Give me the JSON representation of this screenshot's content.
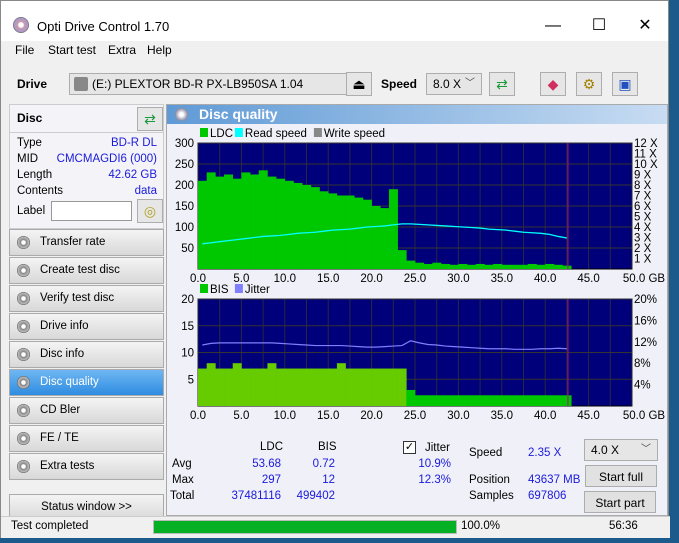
{
  "window": {
    "title": "Opti Drive Control 1.70",
    "minimize": "—",
    "maximize": "☐",
    "close": "✕"
  },
  "menu": [
    "File",
    "Start test",
    "Extra",
    "Help"
  ],
  "toolbar": {
    "drive_label": "Drive",
    "drive_value": "(E:)  PLEXTOR BD-R  PX-LB950SA 1.04",
    "speed_label": "Speed",
    "speed_value": "8.0 X"
  },
  "disc": {
    "title": "Disc",
    "fields": [
      {
        "k": "Type",
        "v": "BD-R DL"
      },
      {
        "k": "MID",
        "v": "CMCMAGDI6 (000)"
      },
      {
        "k": "Length",
        "v": "42.62 GB"
      },
      {
        "k": "Contents",
        "v": "data"
      }
    ],
    "label_label": "Label",
    "label_value": ""
  },
  "nav": [
    "Transfer rate",
    "Create test disc",
    "Verify test disc",
    "Drive info",
    "Disc info",
    "Disc quality",
    "CD Bler",
    "FE / TE",
    "Extra tests"
  ],
  "nav_selected": "Disc quality",
  "status_window_button": "Status window >>",
  "panel_title": "Disc quality",
  "stats": {
    "headers": [
      "LDC",
      "BIS"
    ],
    "rows": [
      {
        "label": "Avg",
        "ldc": "53.68",
        "bis": "0.72",
        "jitter": "10.9%"
      },
      {
        "label": "Max",
        "ldc": "297",
        "bis": "12",
        "jitter": "12.3%"
      },
      {
        "label": "Total",
        "ldc": "37481116",
        "bis": "499402"
      }
    ],
    "jitter_label": "Jitter",
    "jitter_checked": true,
    "speed_label": "Speed",
    "speed_value": "2.35 X",
    "position_label": "Position",
    "position_value": "43637 MB",
    "samples_label": "Samples",
    "samples_value": "697806",
    "speed_select": "4.0 X",
    "start_full": "Start full",
    "start_part": "Start part"
  },
  "statusbar": {
    "text": "Test completed",
    "progress_percent": 100.0,
    "progress_text": "100.0%",
    "time": "56:36"
  },
  "colors": {
    "ldc": "#00c800",
    "read_speed": "#00ffff",
    "bis": "#66cc00",
    "jitter": "#8080ff",
    "plot_bg": "#00007a",
    "progress": "#06b025"
  },
  "chart_data": [
    {
      "type": "bar",
      "legend": [
        "LDC",
        "Read speed",
        "Write speed"
      ],
      "x_ticks": [
        "0.0",
        "5.0",
        "10.0",
        "15.0",
        "20.0",
        "25.0",
        "30.0",
        "35.0",
        "40.0",
        "45.0",
        "50.0 GB"
      ],
      "xlim": [
        0,
        50
      ],
      "ylim": [
        0,
        300
      ],
      "y_ticks": [
        "300",
        "250",
        "200",
        "150",
        "100",
        "50"
      ],
      "y2lim": [
        0,
        12
      ],
      "y2_ticks": [
        "12 X",
        "11 X",
        "10 X",
        "9 X",
        "8 X",
        "7 X",
        "6 X",
        "5 X",
        "4 X",
        "3 X",
        "2 X",
        "1 X"
      ],
      "x": [
        0,
        1,
        2,
        3,
        4,
        5,
        6,
        7,
        8,
        9,
        10,
        11,
        12,
        13,
        14,
        15,
        16,
        17,
        18,
        19,
        20,
        21,
        22,
        23,
        24,
        25,
        26,
        27,
        28,
        29,
        30,
        31,
        32,
        33,
        34,
        35,
        36,
        37,
        38,
        39,
        40,
        41,
        42
      ],
      "ldc": [
        210,
        230,
        220,
        225,
        215,
        230,
        225,
        235,
        220,
        215,
        210,
        205,
        200,
        195,
        185,
        180,
        175,
        175,
        170,
        165,
        150,
        145,
        190,
        45,
        20,
        15,
        12,
        15,
        12,
        10,
        12,
        10,
        12,
        10,
        12,
        10,
        10,
        10,
        12,
        10,
        12,
        10,
        8
      ],
      "read_speed": [
        2.4,
        2.5,
        2.6,
        2.7,
        2.8,
        2.9,
        3.0,
        3.1,
        3.15,
        3.2,
        3.3,
        3.4,
        3.45,
        3.5,
        3.6,
        3.7,
        3.75,
        3.8,
        3.9,
        4.0,
        4.05,
        4.1,
        4.2,
        4.3,
        4.3,
        4.25,
        4.2,
        4.15,
        4.1,
        4.05,
        4.0,
        3.95,
        3.9,
        3.8,
        3.75,
        3.7,
        3.6,
        3.5,
        3.45,
        3.4,
        3.3,
        3.1,
        2.95
      ]
    },
    {
      "type": "bar",
      "legend": [
        "BIS",
        "Jitter"
      ],
      "x_ticks": [
        "0.0",
        "5.0",
        "10.0",
        "15.0",
        "20.0",
        "25.0",
        "30.0",
        "35.0",
        "40.0",
        "45.0",
        "50.0 GB"
      ],
      "xlim": [
        0,
        50
      ],
      "ylim": [
        0,
        20
      ],
      "y_ticks": [
        "20",
        "15",
        "10",
        "5"
      ],
      "y2lim": [
        0,
        20
      ],
      "y2_ticks": [
        "20%",
        "16%",
        "12%",
        "8%",
        "4%"
      ],
      "x": [
        0,
        1,
        2,
        3,
        4,
        5,
        6,
        7,
        8,
        9,
        10,
        11,
        12,
        13,
        14,
        15,
        16,
        17,
        18,
        19,
        20,
        21,
        22,
        23,
        24,
        25,
        26,
        27,
        28,
        29,
        30,
        31,
        32,
        33,
        34,
        35,
        36,
        37,
        38,
        39,
        40,
        41,
        42
      ],
      "bis": [
        7,
        8,
        7,
        7,
        8,
        7,
        7,
        7,
        8,
        7,
        7,
        7,
        7,
        7,
        7,
        7,
        8,
        7,
        7,
        7,
        7,
        7,
        7,
        7,
        3,
        2,
        2,
        2,
        2,
        2,
        2,
        2,
        2,
        2,
        2,
        2,
        2,
        2,
        2,
        2,
        2,
        2,
        2
      ],
      "jitter": [
        11.4,
        11.7,
        11.8,
        11.8,
        11.8,
        11.8,
        11.8,
        11.8,
        11.8,
        11.7,
        11.6,
        11.5,
        11.4,
        11.3,
        11.3,
        11.3,
        11.3,
        11.2,
        11.1,
        11.0,
        11.0,
        11.1,
        11.2,
        11.3,
        12.2,
        11.8,
        11.5,
        11.4,
        11.2,
        11.1,
        11.0,
        10.9,
        10.8,
        10.7,
        10.7,
        10.7,
        10.6,
        10.6,
        10.6,
        10.7,
        10.7,
        10.8,
        10.7
      ]
    }
  ]
}
